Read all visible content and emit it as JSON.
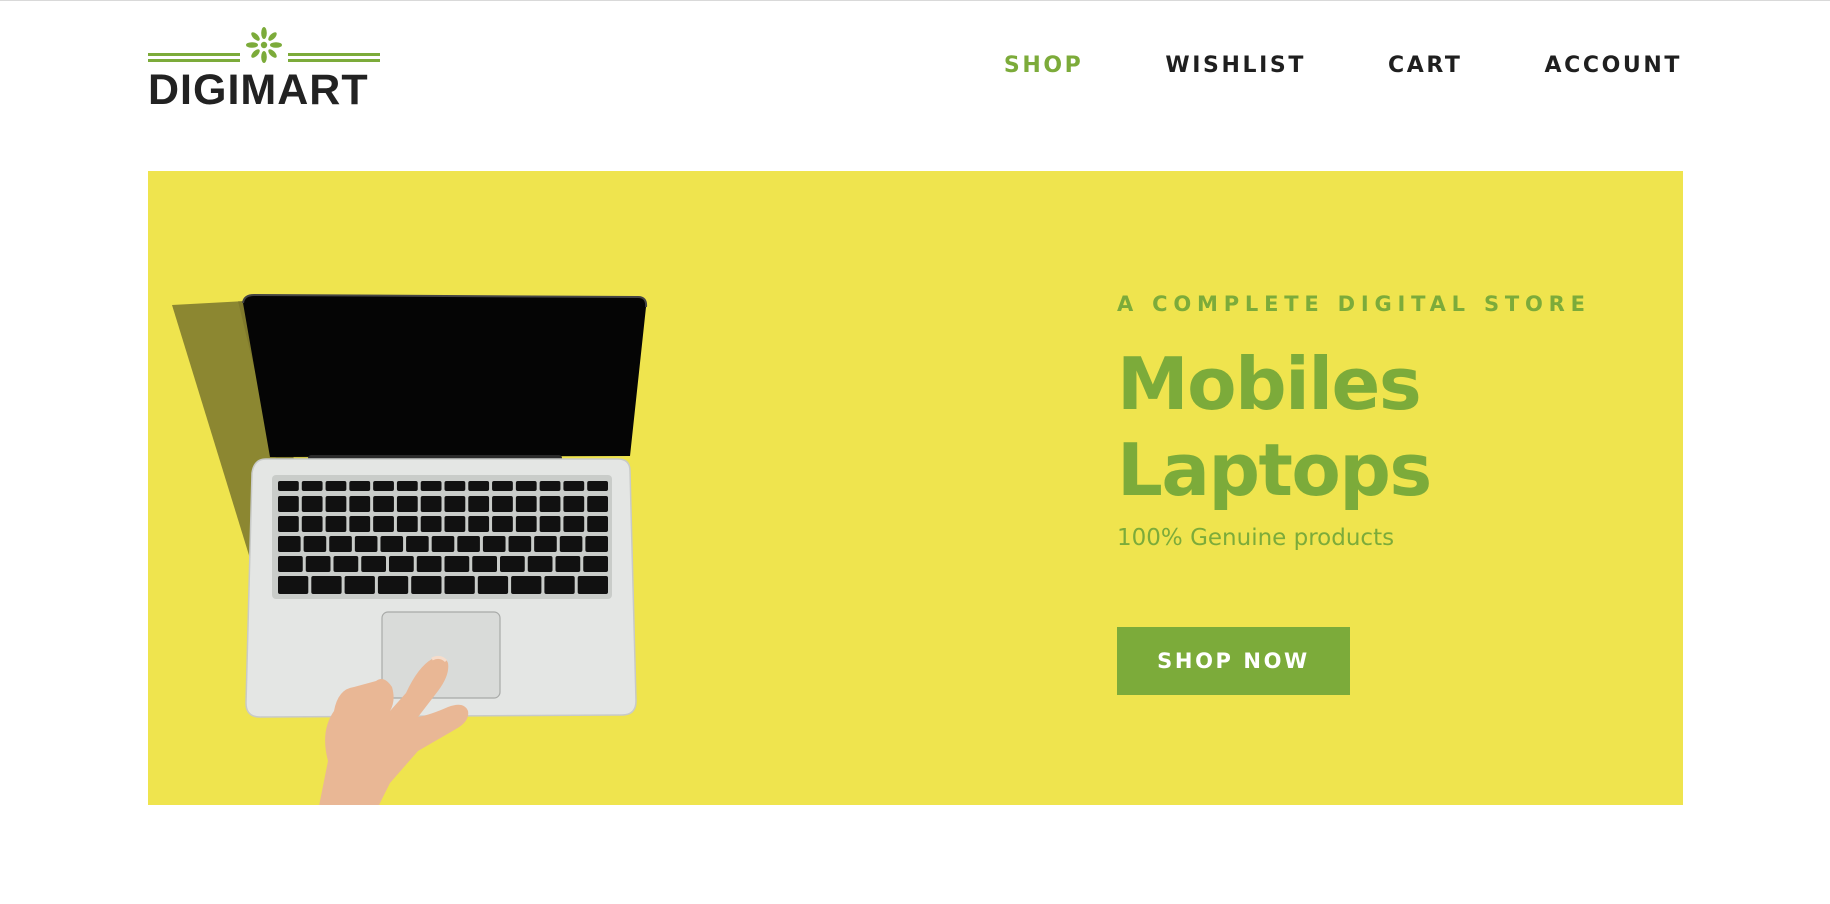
{
  "brand": {
    "name": "DIGIMART",
    "logo_icon": "starburst-icon",
    "accent_color": "#7cab3a",
    "text_color": "#222222"
  },
  "nav": {
    "items": [
      {
        "label": "SHOP",
        "active": true
      },
      {
        "label": "WISHLIST",
        "active": false
      },
      {
        "label": "CART",
        "active": false
      },
      {
        "label": "ACCOUNT",
        "active": false
      }
    ]
  },
  "hero": {
    "background_color": "#efe44e",
    "eyebrow": "A COMPLETE DIGITAL STORE",
    "headline_line1": "Mobiles",
    "headline_line2": "Laptops",
    "subtitle": "100% Genuine products",
    "cta_label": "SHOP NOW",
    "image_subject": "laptop-with-hand"
  }
}
